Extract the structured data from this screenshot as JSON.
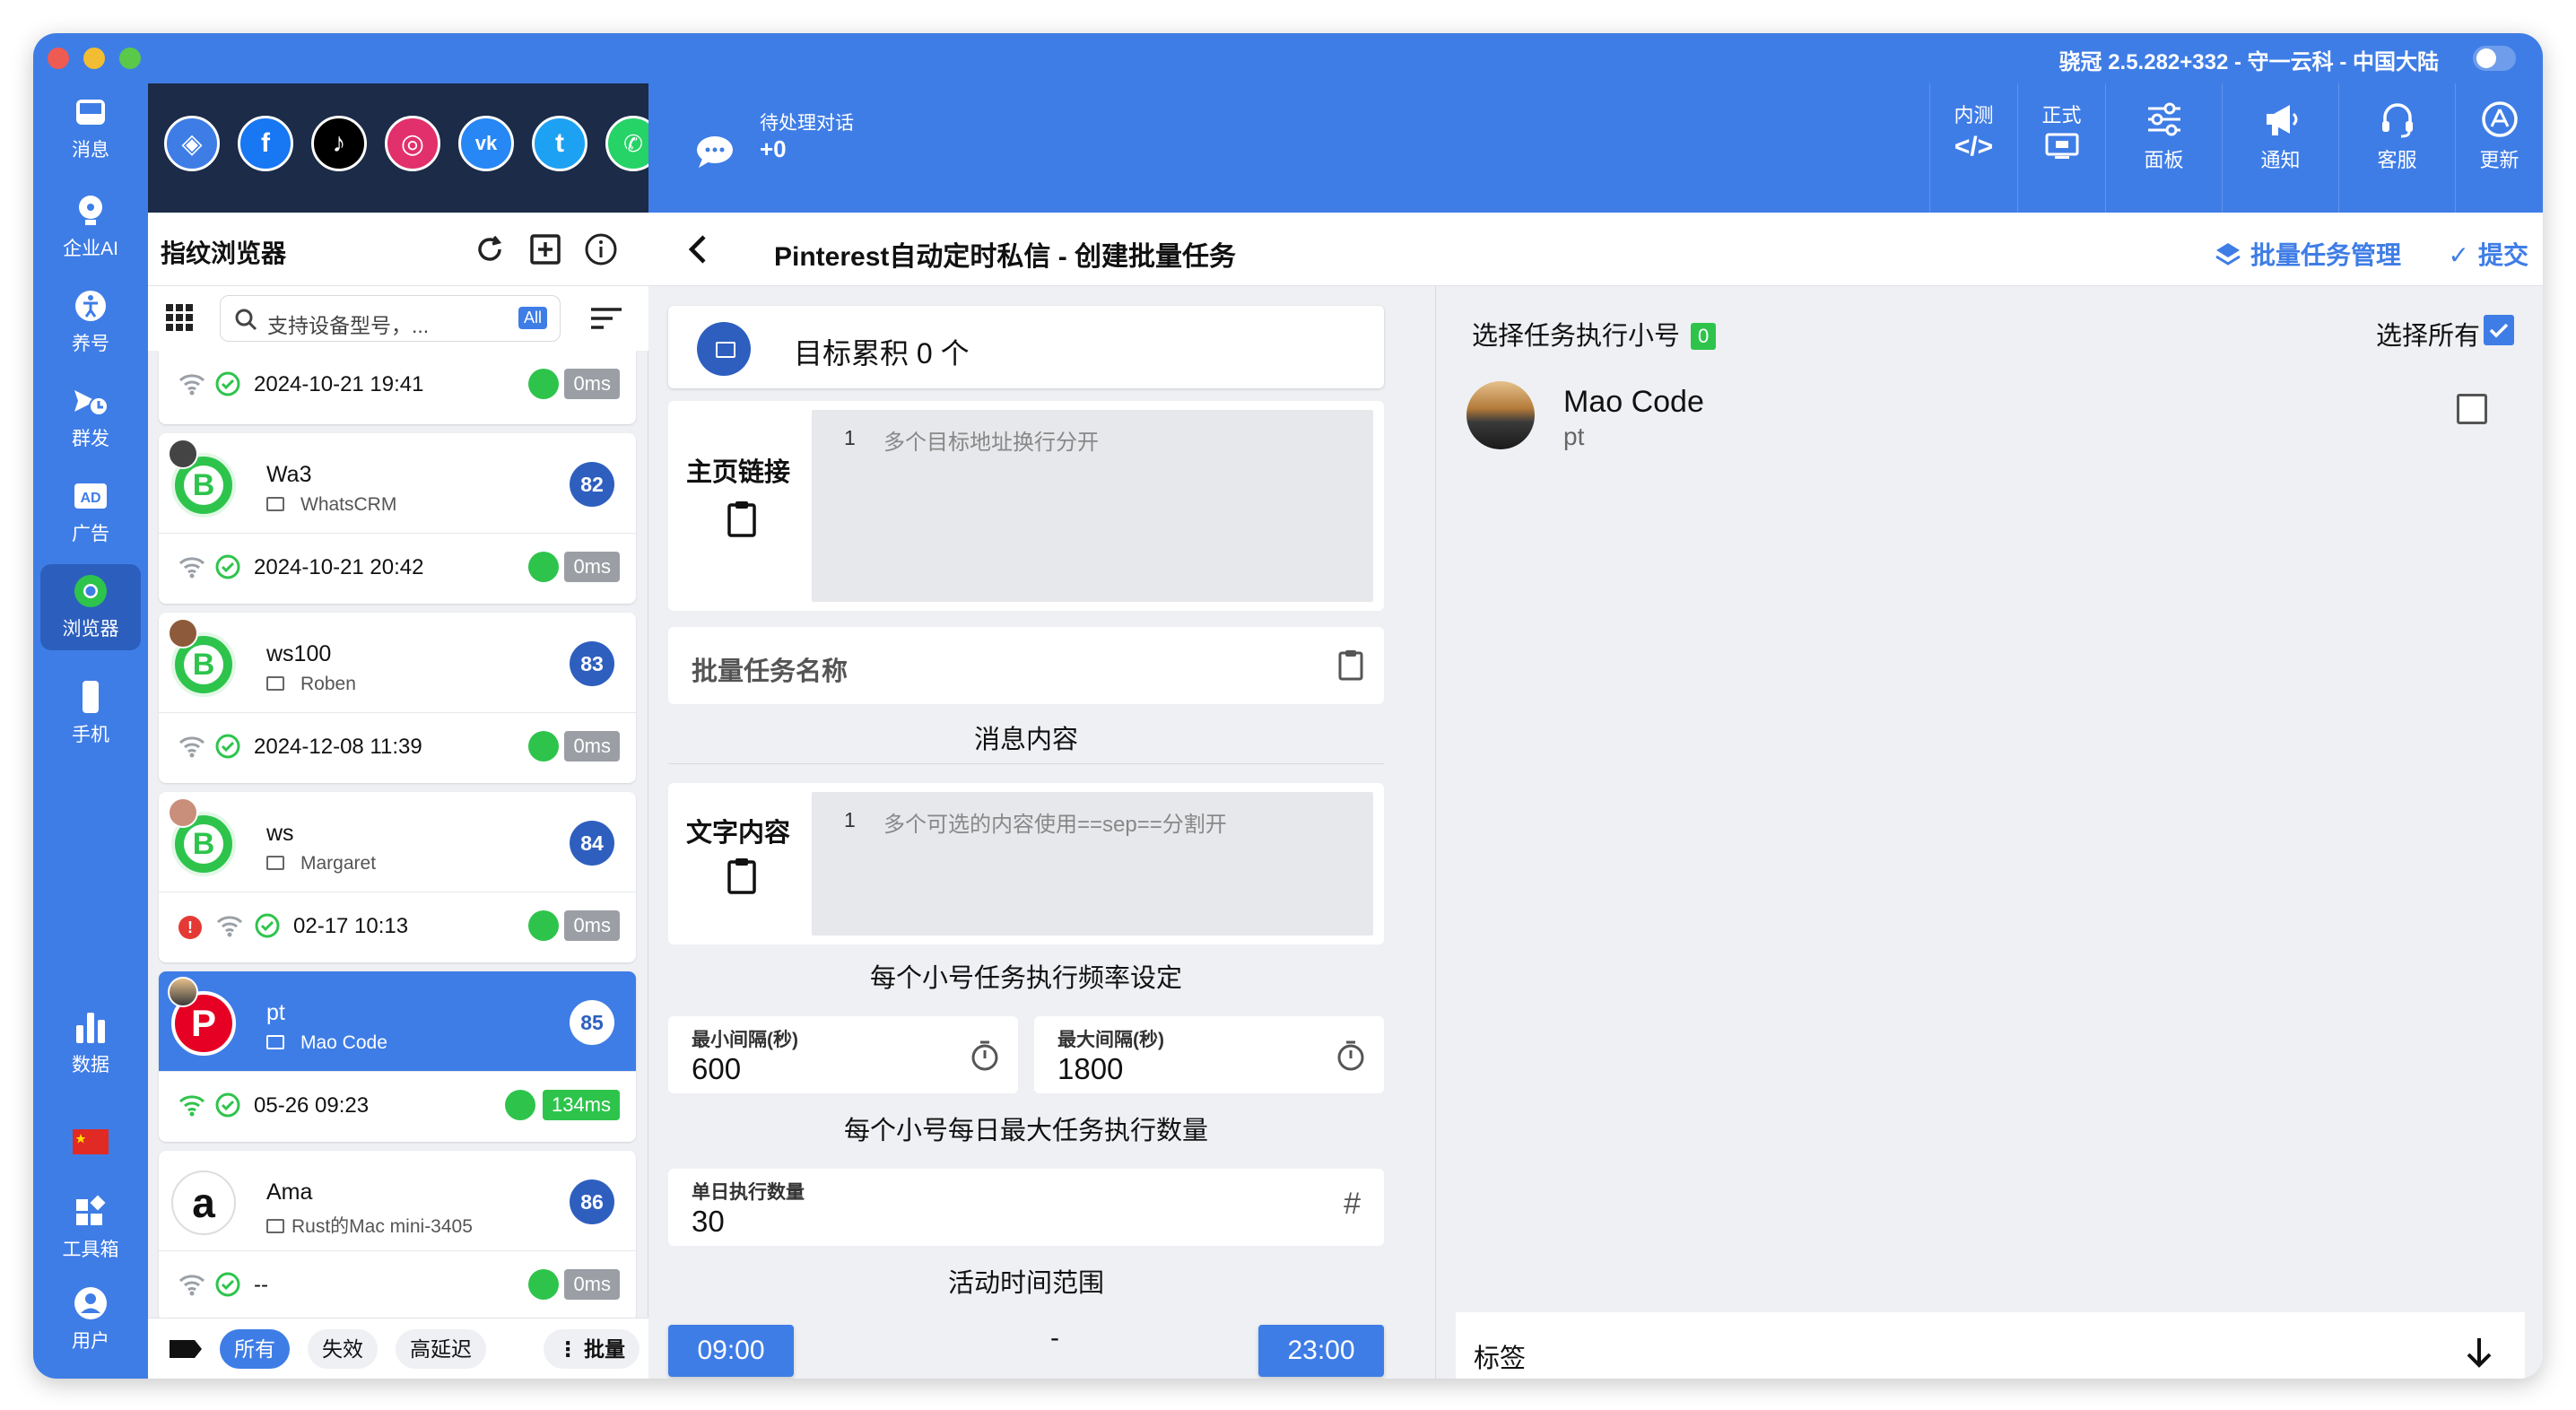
{
  "titlebar": {
    "text": "骁冠 2.5.282+332 - 守一云科 - 中国大陆"
  },
  "rail": {
    "items": [
      {
        "label": "消息",
        "icon": "inbox-icon"
      },
      {
        "label": "企业AI",
        "icon": "ai-icon"
      },
      {
        "label": "养号",
        "icon": "person-icon"
      },
      {
        "label": "群发",
        "icon": "broadcast-icon"
      },
      {
        "label": "广告",
        "icon": "ad-icon"
      },
      {
        "label": "浏览器",
        "icon": "chrome-icon"
      },
      {
        "label": "手机",
        "icon": "phone-icon"
      },
      {
        "label": "数据",
        "icon": "bar-chart-icon"
      },
      {
        "label": "工具箱",
        "icon": "apps-icon"
      },
      {
        "label": "用户",
        "icon": "user-icon"
      }
    ],
    "flag": "china-flag-icon"
  },
  "social": [
    "browser-logo-icon",
    "facebook-icon",
    "tiktok-icon",
    "instagram-icon",
    "vk-icon",
    "twitter-icon",
    "whatsapp-icon"
  ],
  "topbar": {
    "pending_label": "待处理对话",
    "pending_value": "+0",
    "tools": [
      {
        "top": "内测",
        "label": "</>"
      },
      {
        "top": "正式",
        "label": ""
      },
      {
        "label": "面板"
      },
      {
        "label": "通知"
      },
      {
        "label": "客服"
      },
      {
        "label": "更新"
      }
    ]
  },
  "panel": {
    "title": "指纹浏览器",
    "search_placeholder": "支持设备型号，...",
    "search_scope": "All",
    "first_partial_time": "2024-10-21 19:41",
    "first_partial_ms": "0ms",
    "cards": [
      {
        "name": "Wa3",
        "sub": "WhatsCRM",
        "badge": "82",
        "time": "2024-10-21 20:42",
        "ms": "0ms"
      },
      {
        "name": "ws100",
        "sub": "Roben",
        "badge": "83",
        "time": "2024-12-08 11:39",
        "ms": "0ms"
      },
      {
        "name": "ws",
        "sub": "Margaret",
        "badge": "84",
        "time": "02-17 10:13",
        "ms": "0ms"
      },
      {
        "name": "pt",
        "sub": "Mao Code",
        "badge": "85",
        "time": "05-26 09:23",
        "ms": "134ms"
      },
      {
        "name": "Ama",
        "sub": "Rust的Mac mini-3405",
        "badge": "86",
        "time": "--",
        "ms": "0ms"
      }
    ],
    "footer": {
      "all": "所有",
      "invalid": "失效",
      "high_latency": "高延迟",
      "bulk": "批量"
    }
  },
  "main": {
    "title": "Pinterest自动定时私信 - 创建批量任务",
    "manage_link": "批量任务管理",
    "submit": "提交"
  },
  "form": {
    "target_text": "目标累积 0 个",
    "homepage_label": "主页链接",
    "homepage_line": "1",
    "homepage_placeholder": "多个目标地址换行分开",
    "task_name_placeholder": "批量任务名称",
    "message_section": "消息内容",
    "text_label": "文字内容",
    "text_line": "1",
    "text_placeholder": "多个可选的内容使用==sep==分割开",
    "freq_section": "每个小号任务执行频率设定",
    "min_label": "最小间隔(秒)",
    "min_value": "600",
    "max_label": "最大间隔(秒)",
    "max_value": "1800",
    "daily_section": "每个小号每日最大任务执行数量",
    "daily_label": "单日执行数量",
    "daily_value": "30",
    "active_section": "活动时间范围",
    "start_time": "09:00",
    "dash": "-",
    "end_time": "23:00"
  },
  "right": {
    "title": "选择任务执行小号",
    "count": "0",
    "select_all": "选择所有",
    "account_name": "Mao Code",
    "account_sub": "pt",
    "tag_label": "标签"
  },
  "colors": {
    "primary": "#3f7de6",
    "dark": "#1b2b48",
    "green": "#2ec44c",
    "badge": "#2e5fbf"
  }
}
